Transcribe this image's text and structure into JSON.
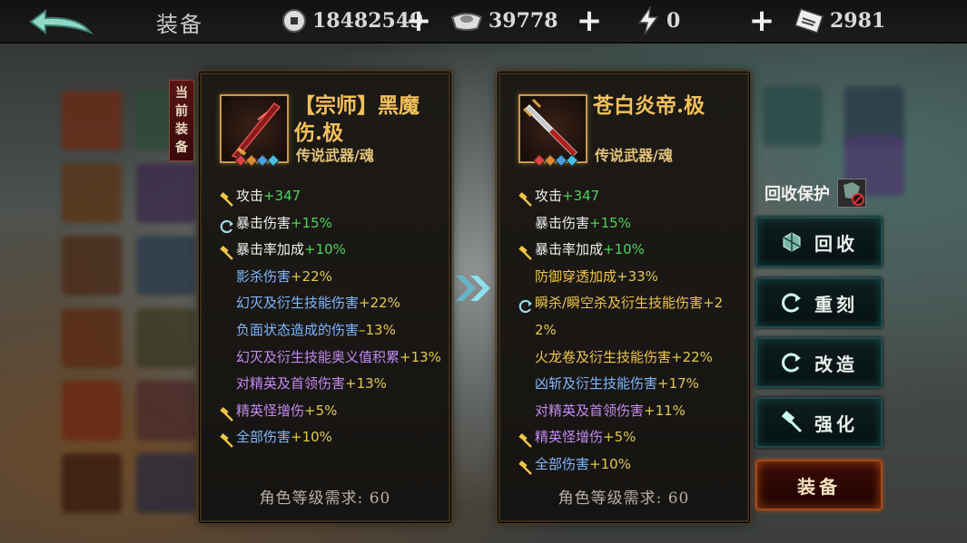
{
  "topbar": {
    "title": "装备",
    "coins": "18482549",
    "ingots": "39778",
    "energy": "0",
    "tickets": "2981",
    "plus": "+"
  },
  "current_tag": "当前装备",
  "left_item": {
    "name": "【宗师】黑魔伤.极",
    "type": "传说武器/魂",
    "stats": [
      {
        "icon": "hammer-icon",
        "name": "攻击",
        "value": "+347",
        "color": "white"
      },
      {
        "icon": "refresh-icon",
        "name": "暴击伤害",
        "value": "+15%",
        "color": "white"
      },
      {
        "icon": "hammer-icon",
        "name": "暴击率加成",
        "value": "+10%",
        "color": "white"
      },
      {
        "icon": "",
        "name": "影杀伤害",
        "value": "+22%",
        "color": "blue"
      },
      {
        "icon": "",
        "name": "幻灭及衍生技能伤害",
        "value": "+22%",
        "color": "blue"
      },
      {
        "icon": "",
        "name": "负面状态造成的伤害",
        "value": "–13%",
        "color": "blue"
      },
      {
        "icon": "",
        "name": "幻灭及衍生技能奥义值积累",
        "value": "+13%",
        "color": "purple"
      },
      {
        "icon": "",
        "name": "对精英及首领伤害",
        "value": "+13%",
        "color": "purple"
      },
      {
        "icon": "hammer-icon",
        "name": "精英怪增伤",
        "value": "+5%",
        "color": "purple"
      },
      {
        "icon": "hammer-icon",
        "name": "全部伤害",
        "value": "+10%",
        "color": "blue"
      }
    ],
    "level_req": "角色等级需求: 60"
  },
  "right_item": {
    "name": "苍白炎帝.极",
    "type": "传说武器/魂",
    "stats": [
      {
        "icon": "hammer-icon",
        "name": "攻击",
        "value": "+347",
        "color": "white"
      },
      {
        "icon": "",
        "name": "暴击伤害",
        "value": "+15%",
        "color": "white"
      },
      {
        "icon": "hammer-icon",
        "name": "暴击率加成",
        "value": "+10%",
        "color": "white"
      },
      {
        "icon": "",
        "name": "防御穿透加成",
        "value": "+33%",
        "color": "gold"
      },
      {
        "icon": "refresh-icon",
        "name": "瞬杀/瞬空杀及衍生技能伤害",
        "value": "+22%",
        "color": "gold"
      },
      {
        "icon": "",
        "name": "火龙卷及衍生技能伤害",
        "value": "+22%",
        "color": "gold"
      },
      {
        "icon": "",
        "name": "凶斩及衍生技能伤害",
        "value": "+17%",
        "color": "blue"
      },
      {
        "icon": "",
        "name": "对精英及首领伤害",
        "value": "+11%",
        "color": "purple"
      },
      {
        "icon": "hammer-icon",
        "name": "精英怪增伤",
        "value": "+5%",
        "color": "purple"
      },
      {
        "icon": "hammer-icon",
        "name": "全部伤害",
        "value": "+10%",
        "color": "blue"
      }
    ],
    "level_req": "角色等级需求: 60"
  },
  "controls": {
    "recycle_protect": "回收保护",
    "recycle": "回收",
    "reforge": "重刻",
    "modify": "改造",
    "enhance": "强化",
    "equip": "装备"
  },
  "colors": {
    "gold_name": "#f3c05a",
    "stat_value_green": "#4fd35a",
    "equip_glow": "#a34a18"
  }
}
